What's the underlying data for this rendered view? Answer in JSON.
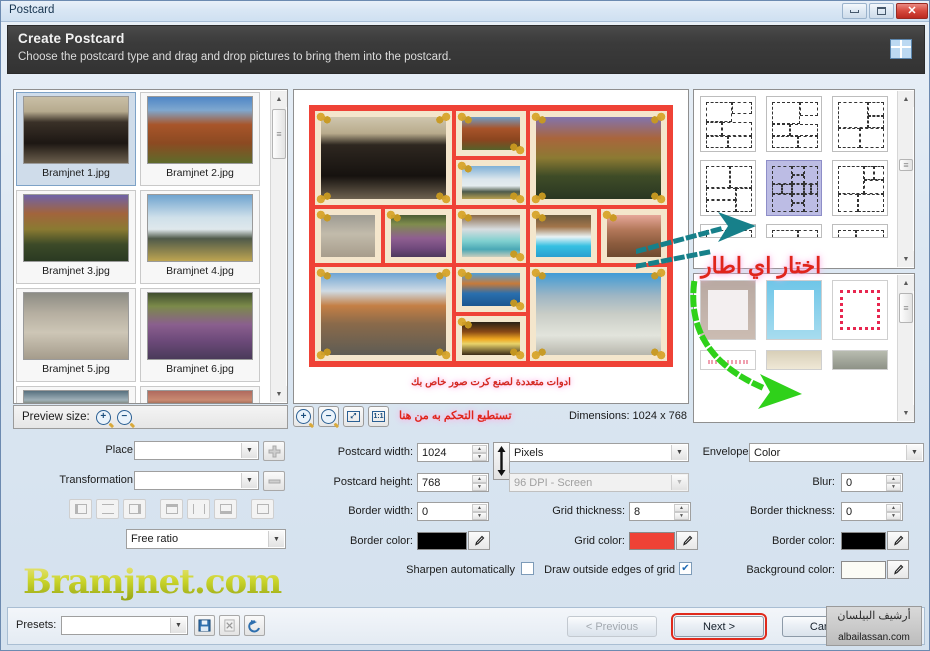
{
  "window": {
    "title": "Postcard",
    "minimize_label": "Minimize",
    "maximize_label": "Maximize",
    "close_label": "✕"
  },
  "header": {
    "title": "Create Postcard",
    "subtitle": "Choose the postcard type and drag and drop pictures to bring them into the postcard."
  },
  "thumbnails": {
    "items": [
      {
        "caption": "Bramjnet  1.jpg",
        "selected": true
      },
      {
        "caption": "Bramjnet  2.jpg",
        "selected": false
      },
      {
        "caption": "Bramjnet  3.jpg",
        "selected": false
      },
      {
        "caption": "Bramjnet  4.jpg",
        "selected": false
      },
      {
        "caption": "Bramjnet  5.jpg",
        "selected": false
      },
      {
        "caption": "Bramjnet  6.jpg",
        "selected": false
      }
    ],
    "preview_size_label": "Preview size:",
    "zoom_in": "+",
    "zoom_out": "−"
  },
  "preview": {
    "zoom_in": "+",
    "zoom_out": "−",
    "fit_label": "⤢",
    "actual_size_label": "1:1",
    "dimensions_label": "Dimensions: 1024 x 768",
    "annotation_top": "ادوات متعددة لصنع كرت صور خاص بك",
    "annotation_bottom": "تستطيع التحكم به من هنا"
  },
  "templates": {
    "annotation": "اختار اي اطار",
    "selected_index": 4
  },
  "controls": {
    "place_label": "Place:",
    "place_value": "",
    "transformation_label": "Transformation:",
    "transformation_value": "",
    "ratio_value": "Free ratio",
    "add_button": "+",
    "remove_button": "−",
    "postcard_width_label": "Postcard width:",
    "postcard_width_value": "1024",
    "postcard_height_label": "Postcard height:",
    "postcard_height_value": "768",
    "border_width_label": "Border width:",
    "border_width_value": "0",
    "border_color_label": "Border color:",
    "border_color_value": "#000000",
    "sharpen_label": "Sharpen automatically",
    "sharpen_checked": false,
    "units_value": "Pixels",
    "dpi_value": "96 DPI - Screen",
    "grid_thickness_label": "Grid thickness:",
    "grid_thickness_value": "8",
    "grid_color_label": "Grid color:",
    "grid_color_value": "#ef4236",
    "draw_outside_label": "Draw outside edges of grid",
    "draw_outside_checked": true,
    "envelopes_label": "Envelopes:",
    "envelopes_value": "Color",
    "blur_label": "Blur:",
    "blur_value": "0",
    "env_border_thickness_label": "Border thickness:",
    "env_border_thickness_value": "0",
    "env_border_color_label": "Border color:",
    "env_border_color_value": "#000000",
    "background_color_label": "Background color:",
    "background_color_value": "#fbfbf5"
  },
  "footer": {
    "presets_label": "Presets:",
    "presets_value": "",
    "save_icon": "save-icon",
    "delete_icon": "delete-icon",
    "reset_icon": "reset-icon",
    "previous_label": "< Previous",
    "next_label": "Next >",
    "cancel_label": "Cancel"
  },
  "watermarks": {
    "brand": "Bramjnet.com",
    "site": "albailassan.com"
  },
  "colors": {
    "accent_red": "#ef4236",
    "header_dark": "#3b3b3b",
    "selection_blue": "#bcbce4",
    "annotation_red": "#e0251b",
    "arrow_teal": "#17808a",
    "arrow_green": "#2fd11a"
  }
}
